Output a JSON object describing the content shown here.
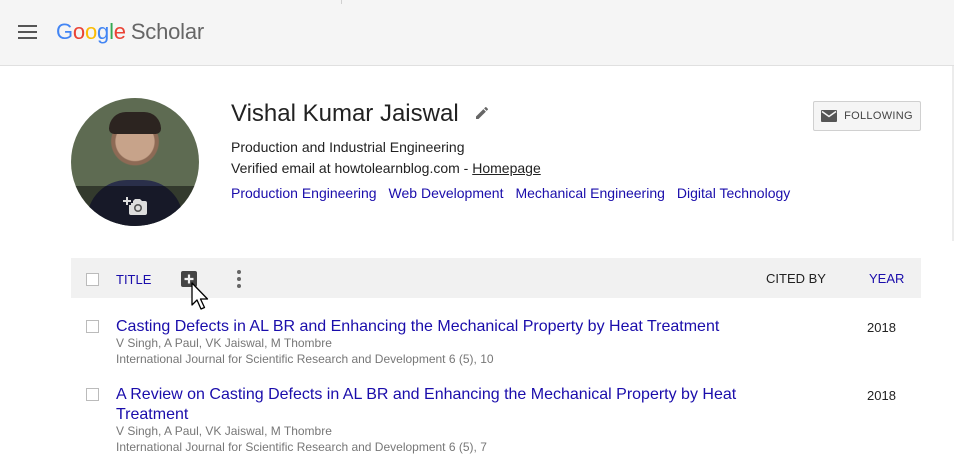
{
  "header": {
    "logo_parts": [
      "G",
      "o",
      "o",
      "g",
      "l",
      "e"
    ],
    "product": "Scholar"
  },
  "profile": {
    "name": "Vishal Kumar Jaiswal",
    "affiliation": "Production and Industrial Engineering",
    "email_text": "Verified email at howtolearnblog.com - ",
    "homepage_label": "Homepage",
    "interests": [
      "Production Engineering",
      "Web Development",
      "Mechanical Engineering",
      "Digital Technology"
    ],
    "follow_label": "FOLLOWING"
  },
  "table": {
    "title_header": "TITLE",
    "cited_by_header": "CITED BY",
    "year_header": "YEAR",
    "rows": [
      {
        "title": "Casting Defects in AL BR and Enhancing the Mechanical Property by Heat Treatment",
        "authors": "V Singh, A Paul, VK Jaiswal, M Thombre",
        "venue": "International Journal for Scientific Research and Development 6 (5), 10",
        "year": "2018"
      },
      {
        "title": "A Review on Casting Defects in AL BR and Enhancing the Mechanical Property by Heat Treatment",
        "authors": "V Singh, A Paul, VK Jaiswal, M Thombre",
        "venue": "International Journal for Scientific Research and Development 6 (5), 7",
        "year": "2018"
      }
    ]
  },
  "icons": [
    "menu-icon",
    "edit-icon",
    "camera-add-icon",
    "mail-icon",
    "add-box-icon",
    "more-vert-icon",
    "mouse-pointer-icon"
  ]
}
